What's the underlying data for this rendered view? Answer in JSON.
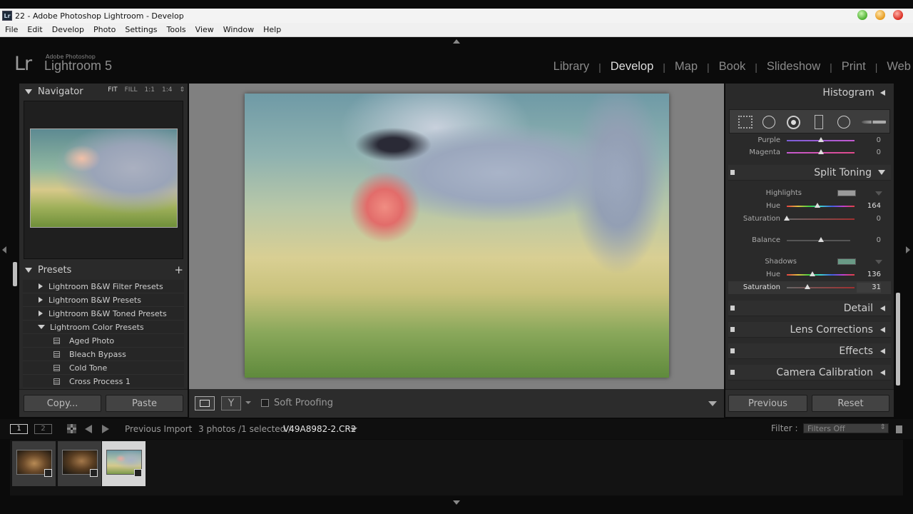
{
  "window": {
    "title": "22 - Adobe Photoshop Lightroom - Develop",
    "icon_text": "Lr",
    "controls": [
      "minimize",
      "maximize",
      "close"
    ]
  },
  "menu": [
    "File",
    "Edit",
    "Develop",
    "Photo",
    "Settings",
    "Tools",
    "View",
    "Window",
    "Help"
  ],
  "identity": {
    "lr": "Lr",
    "sub": "Adobe Photoshop",
    "name": "Lightroom 5"
  },
  "modules": [
    {
      "label": "Library",
      "active": false
    },
    {
      "label": "Develop",
      "active": true
    },
    {
      "label": "Map",
      "active": false
    },
    {
      "label": "Book",
      "active": false
    },
    {
      "label": "Slideshow",
      "active": false
    },
    {
      "label": "Print",
      "active": false
    },
    {
      "label": "Web",
      "active": false
    }
  ],
  "navigator": {
    "title": "Navigator",
    "zoom": [
      "FIT",
      "FILL",
      "1:1",
      "1:4"
    ]
  },
  "presets": {
    "title": "Presets",
    "add": "+",
    "folders": [
      "Lightroom B&W Filter Presets",
      "Lightroom B&W Presets",
      "Lightroom B&W Toned Presets",
      "Lightroom Color Presets"
    ],
    "items": [
      "Aged Photo",
      "Bleach Bypass",
      "Cold Tone",
      "Cross Process 1"
    ]
  },
  "left_buttons": {
    "copy": "Copy...",
    "paste": "Paste"
  },
  "toolbar": {
    "soft_proofing": "Soft Proofing"
  },
  "right": {
    "histogram": "Histogram",
    "hsl_partial": [
      {
        "label": "Purple",
        "value": "0",
        "pos": 0.5
      },
      {
        "label": "Magenta",
        "value": "0",
        "pos": 0.5
      }
    ],
    "split_toning": {
      "title": "Split Toning",
      "highlights_label": "Highlights",
      "highlights_swatch": "#9a9a9a",
      "sliders_high": [
        {
          "label": "Hue",
          "value": "164",
          "pos": 0.455
        },
        {
          "label": "Saturation",
          "value": "0",
          "pos": 0.0
        }
      ],
      "balance": {
        "label": "Balance",
        "value": "0",
        "pos": 0.5
      },
      "shadows_label": "Shadows",
      "shadows_swatch": "#6a9a86",
      "sliders_shadow": [
        {
          "label": "Hue",
          "value": "136",
          "pos": 0.378
        },
        {
          "label": "Saturation",
          "value": "31",
          "pos": 0.31
        }
      ]
    },
    "panels": [
      "Detail",
      "Lens Corrections",
      "Effects",
      "Camera Calibration"
    ],
    "buttons": {
      "previous": "Previous",
      "reset": "Reset"
    }
  },
  "filmstrip": {
    "pages": [
      "1",
      "2"
    ],
    "source": "Previous Import",
    "count": "3 photos /1 selected /",
    "filename": "V49A8982-2.CR2",
    "filter_label": "Filter :",
    "filter_value": "Filters Off"
  },
  "colors": {
    "panel": "#2a2a2a",
    "bg": "#0b0b0b",
    "active_text": "#dedede"
  }
}
